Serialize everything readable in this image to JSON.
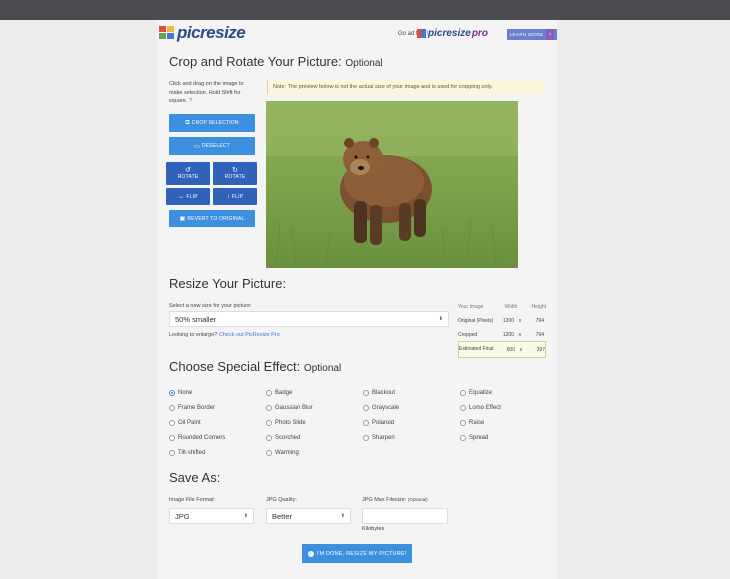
{
  "header": {
    "logo_text": "picresize",
    "ad_free_text": "Go ad free!",
    "pro_logo_text": "picresize",
    "pro_logo_suffix": "pro",
    "learn_more_label": "LEARN MORE",
    "learn_more_arrow": "›"
  },
  "crop_section": {
    "title": "Crop and Rotate Your Picture:",
    "title_optional": "Optional",
    "help_text": "Click and drag on the image to make selection. Hold Shift for square.",
    "help_icon": "?",
    "crop_button": "CROP SELECTION",
    "deselect_button": "DESELECT",
    "rotate_left_button": "ROTATE",
    "rotate_right_button": "ROTATE",
    "flip_horizontal_button": "FLIP",
    "flip_vertical_button": "FLIP",
    "revert_button": "REVERT TO ORIGINAL",
    "note": "Note: The preview below is not the actual size of your image and is used for cropping only."
  },
  "resize_section": {
    "title": "Resize Your Picture:",
    "select_label": "Select a new size for your picture:",
    "select_value": "50% smaller",
    "enlarge_text": "Looking to enlarge?",
    "enlarge_link": "Check out PicResize Pro",
    "table": {
      "headers": [
        "Your Image",
        "Width",
        "Height"
      ],
      "rows": [
        {
          "label": "Original (Pixels)",
          "width": "1200",
          "x": "x",
          "height": "794"
        },
        {
          "label": "Cropped",
          "width": "1200",
          "x": "x",
          "height": "794"
        },
        {
          "label": "Estimated Final",
          "width": "600",
          "x": "x",
          "height": "397"
        }
      ]
    }
  },
  "effect_section": {
    "title": "Choose Special Effect:",
    "title_optional": "Optional",
    "columns": [
      [
        "None",
        "Frame Border",
        "Oil Paint",
        "Rounded Corners",
        "Tilt-shifted"
      ],
      [
        "Badge",
        "Gaussian Blur",
        "Photo Slide",
        "Scorched",
        "Warming"
      ],
      [
        "Blackout",
        "Grayscale",
        "Polaroid",
        "Sharpen"
      ],
      [
        "Equalize",
        "Lomo Effect",
        "Raise",
        "Spread"
      ]
    ],
    "selected": "None"
  },
  "save_section": {
    "title": "Save As:",
    "format_label": "Image File Format:",
    "format_value": "JPG",
    "quality_label": "JPG Quality:",
    "quality_value": "Better",
    "maxsize_label": "JPG Max Filesize:",
    "maxsize_optional": "(Optional)",
    "maxsize_value": "",
    "maxsize_unit": "Kilobytes",
    "submit_label": "I'M DONE, RESIZE MY PICTURE!"
  },
  "colors": {
    "primary_button": "#3d8fe0",
    "navy_button": "#2f62b8",
    "top_bar": "#4a4c52",
    "note_bg": "#fcf6dc"
  }
}
